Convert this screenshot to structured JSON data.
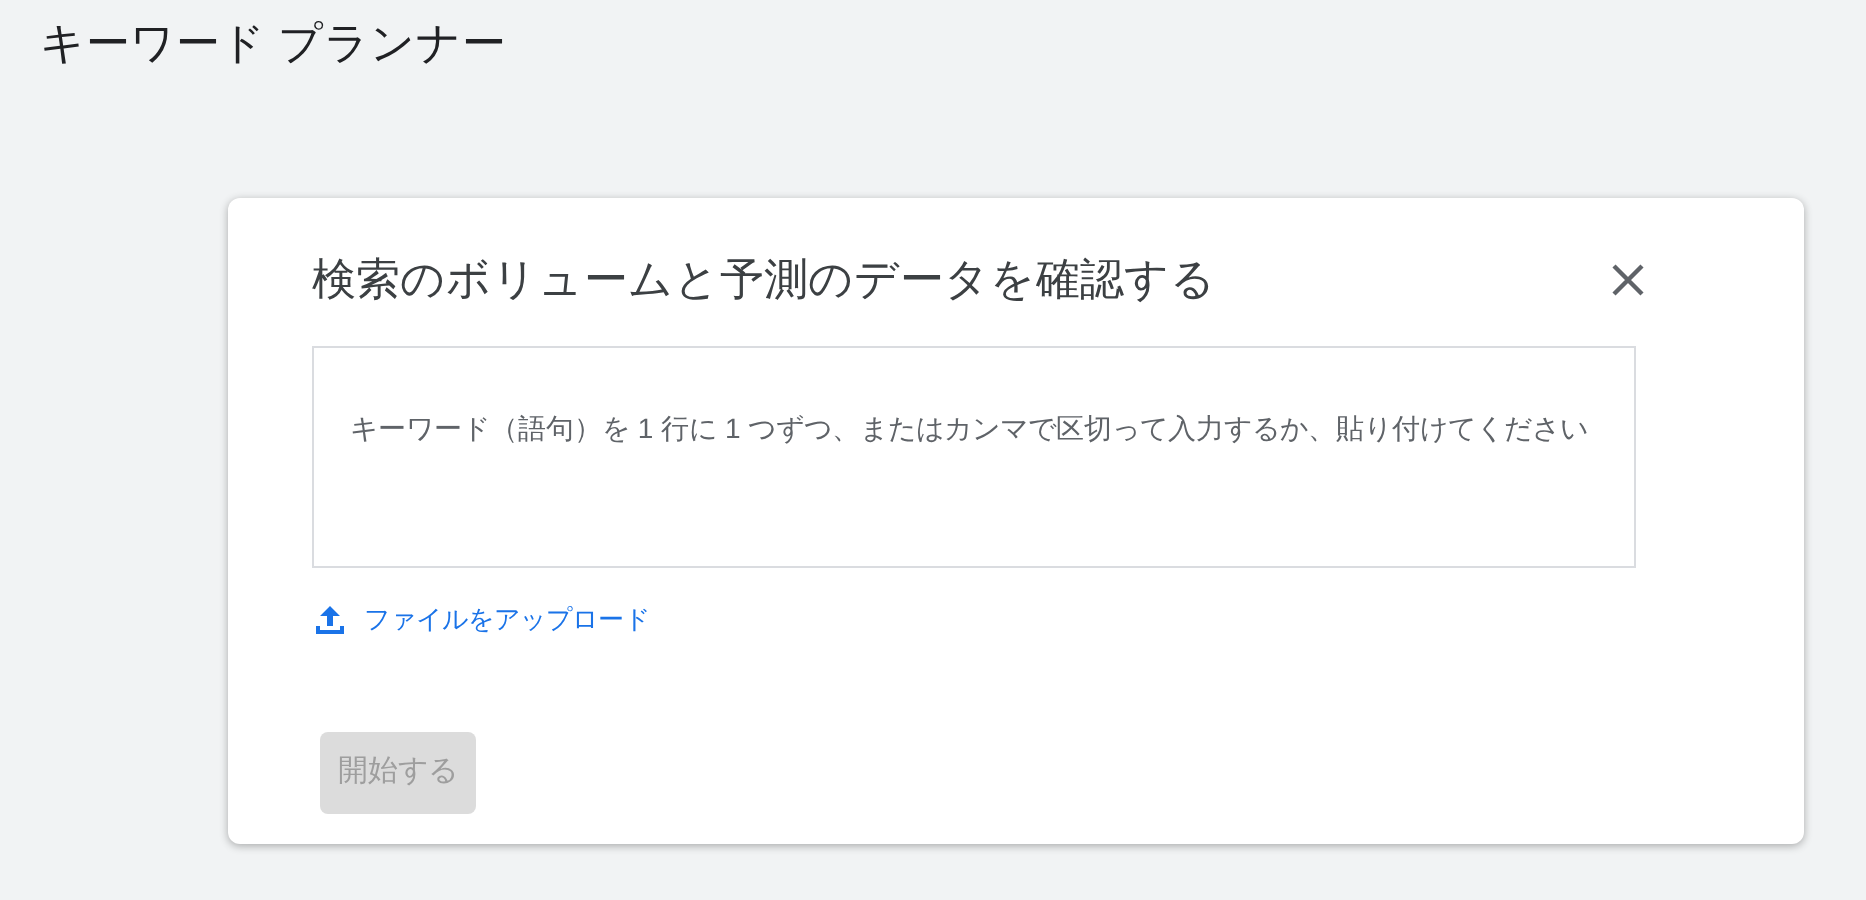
{
  "page_title": "キーワード プランナー",
  "dialog": {
    "title": "検索のボリュームと予測のデータを確認する",
    "keywords_field": {
      "placeholder": "キーワード（語句）を 1 行に 1 つずつ、またはカンマで区切って入力するか、貼り付けてください"
    },
    "upload_link": "ファイルをアップロード",
    "start_button": {
      "label": "開始する",
      "disabled": true
    }
  }
}
